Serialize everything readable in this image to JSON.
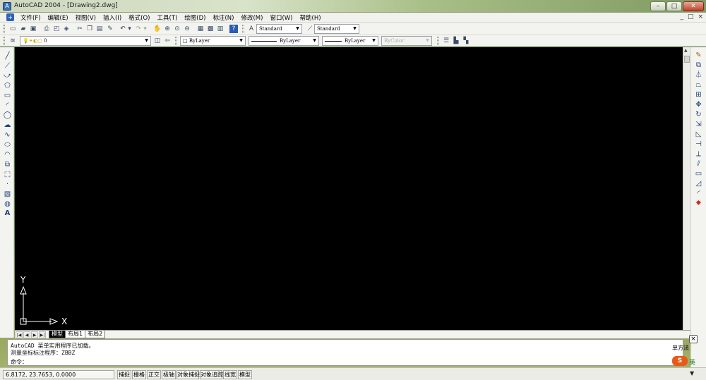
{
  "window": {
    "title": "AutoCAD 2004 - [Drawing2.dwg]",
    "icon": "autocad-app-icon",
    "controls": {
      "minimize": "–",
      "maximize": "□",
      "close": "✕"
    }
  },
  "menubar": {
    "items": [
      "文件(F)",
      "编辑(E)",
      "视图(V)",
      "插入(I)",
      "格式(O)",
      "工具(T)",
      "绘图(D)",
      "标注(N)",
      "修改(M)",
      "窗口(W)",
      "帮助(H)"
    ],
    "right_controls": [
      "_",
      "□",
      "×"
    ]
  },
  "toolbar": {
    "text_style": "Standard",
    "dim_style": "Standard",
    "layer": "0",
    "color": "ByLayer",
    "linetype": "ByLayer",
    "lineweight": "ByLayer",
    "plot_style": "ByColor"
  },
  "drawing": {
    "background": "#000000",
    "ucs": {
      "x_label": "X",
      "y_label": "Y"
    }
  },
  "layout_tabs": {
    "nav": [
      "|◀",
      "◀",
      "▶",
      "▶|"
    ],
    "tabs": [
      "模型",
      "布局1",
      "布局2"
    ],
    "active": 0
  },
  "command_window": {
    "lines": [
      "AutoCAD 菜单实用程序已加载。",
      "测量坐标标注程序：ZBBZ",
      "命令："
    ],
    "ime_hint": "单方法"
  },
  "statusbar": {
    "coords": "6.8172,   23.7653,   0.0000",
    "toggles": [
      "捕捉",
      "栅格",
      "正交",
      "极轴",
      "对象捕捉",
      "对象追踪",
      "线宽",
      "模型"
    ]
  },
  "tray": {
    "ime_badge": "S",
    "ime_lang": "英",
    "down_arrow": "▼"
  }
}
